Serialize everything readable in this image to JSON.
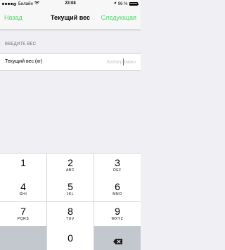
{
  "status_bar": {
    "carrier": "Билайн",
    "time": "23:08",
    "battery_text": "96 %",
    "battery_level": 0.96,
    "wifi_icon": "wifi-icon",
    "location_icon": "location-arrow-icon"
  },
  "nav": {
    "back_label": "Назад",
    "title": "Текущий вес",
    "next_label": "Следующая",
    "accent_color": "#4cd964"
  },
  "section": {
    "header": "ВВЕДИТЕ ВЕС"
  },
  "form": {
    "label": "Текущий вес (кг)",
    "value": "",
    "placeholder": "Килограммы"
  },
  "keypad": {
    "keys": [
      {
        "digit": "1",
        "letters": ""
      },
      {
        "digit": "2",
        "letters": "ABC"
      },
      {
        "digit": "3",
        "letters": "DEF"
      },
      {
        "digit": "4",
        "letters": "GHI"
      },
      {
        "digit": "5",
        "letters": "JKL"
      },
      {
        "digit": "6",
        "letters": "MNO"
      },
      {
        "digit": "7",
        "letters": "PQRS"
      },
      {
        "digit": "8",
        "letters": "TUV"
      },
      {
        "digit": "9",
        "letters": "WXYZ"
      },
      {
        "digit": "0",
        "letters": ""
      }
    ],
    "backspace_icon": "backspace-icon"
  }
}
